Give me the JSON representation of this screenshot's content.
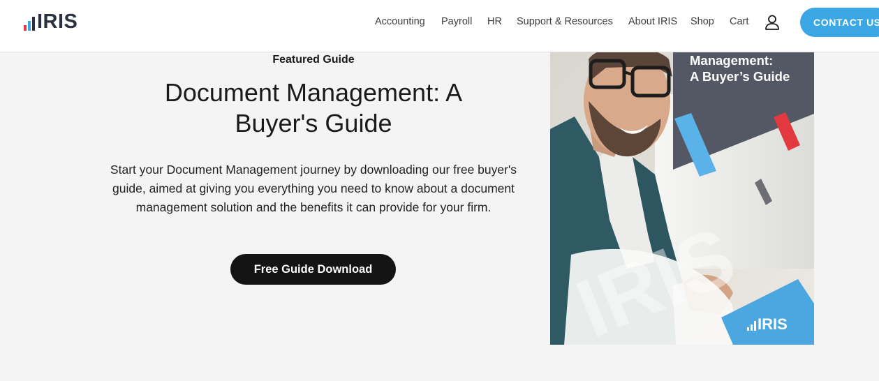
{
  "header": {
    "logo_text": "IRIS",
    "nav": [
      {
        "label": "Accounting"
      },
      {
        "label": "Payroll"
      },
      {
        "label": "HR"
      },
      {
        "label": "Support & Resources"
      },
      {
        "label": "About IRIS"
      },
      {
        "label": "Shop"
      },
      {
        "label": "Cart"
      }
    ],
    "account_icon": "user-icon",
    "contact_label": "CONTACT US"
  },
  "hero": {
    "kicker": "Featured Guide",
    "title": "Document Management: A Buyer's Guide",
    "description": "Start your Document Management journey by downloading our free buyer's guide, aimed at giving you everything you need to know about a document management solution and the benefits it can provide for your firm.",
    "cta_label": "Free Guide Download"
  },
  "cover": {
    "title_line1": "Management:",
    "title_line2": "A Buyer’s Guide",
    "logo_text": "IRIS"
  },
  "colors": {
    "brand_blue": "#3ba7e4",
    "brand_dark": "#2b3040",
    "logo_red": "#e2383f",
    "cta_black": "#141414"
  }
}
